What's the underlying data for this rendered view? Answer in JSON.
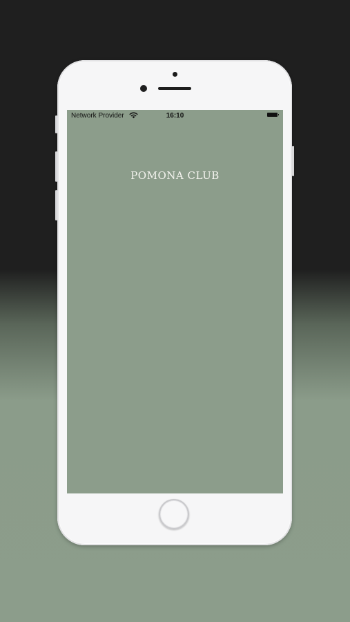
{
  "status_bar": {
    "carrier": "Network Provider",
    "time": "16:10",
    "wifi_icon": "wifi-icon",
    "battery_icon": "battery-icon"
  },
  "app": {
    "title": "POMONA CLUB",
    "background_color": "#8c9d8b"
  }
}
